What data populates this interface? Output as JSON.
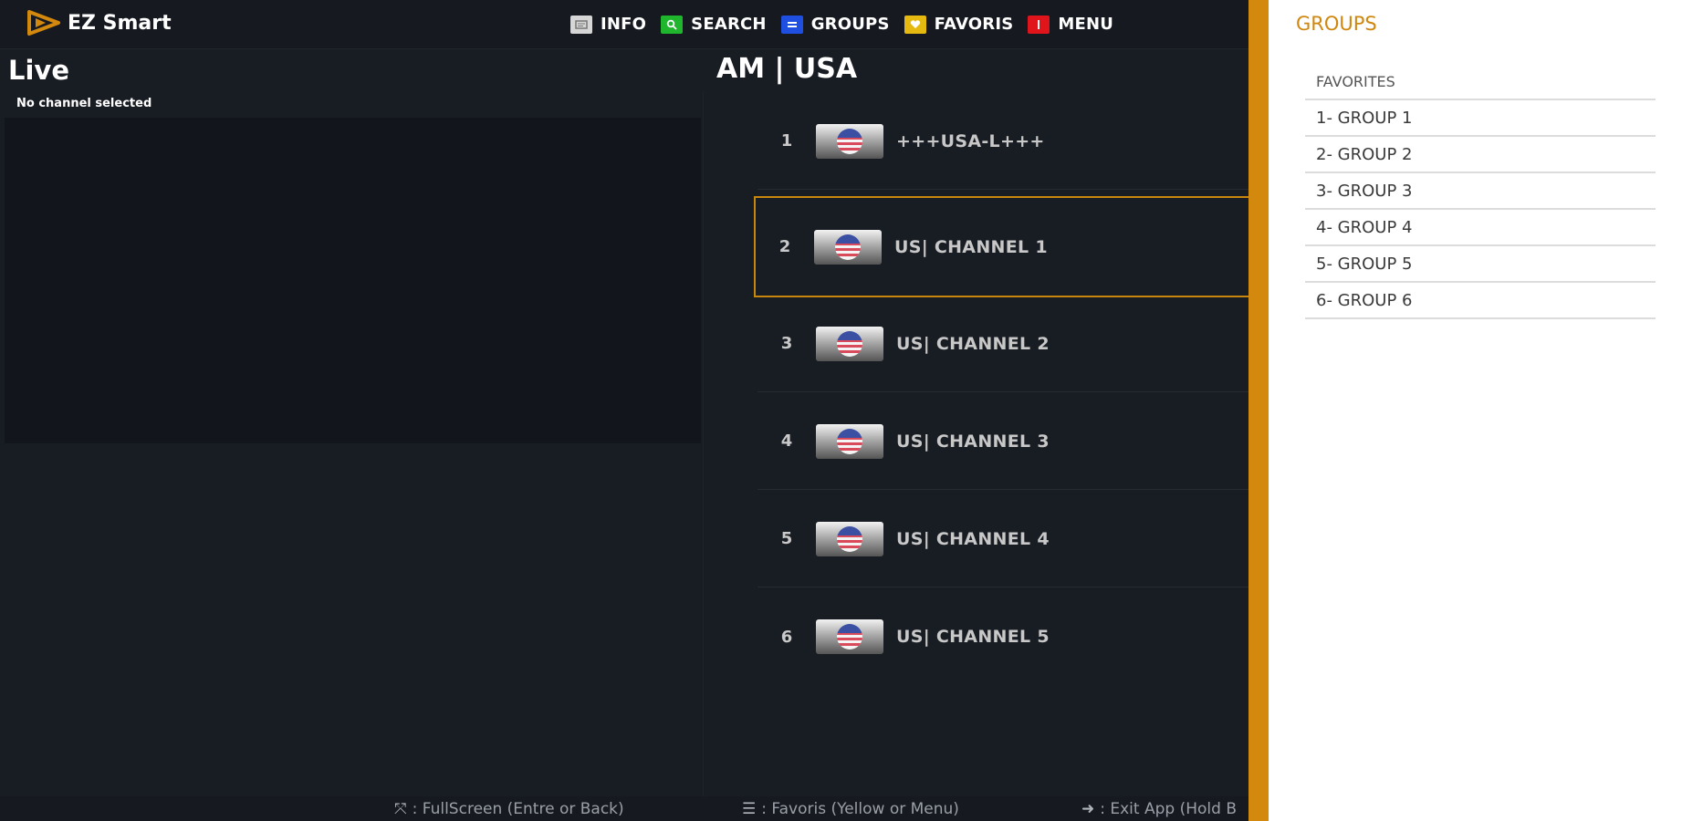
{
  "app": {
    "name": "EZ Smart",
    "brand_color": "#d3880e"
  },
  "header": {
    "hotkeys": [
      {
        "label": "INFO",
        "color": "#d6d6d6",
        "icon": "info-card-icon"
      },
      {
        "label": "SEARCH",
        "color": "#1fb52c",
        "icon": "search-icon"
      },
      {
        "label": "GROUPS",
        "color": "#1f4fe0",
        "icon": "list-icon"
      },
      {
        "label": "FAVORIS",
        "color": "#e5b90f",
        "icon": "heart-icon"
      },
      {
        "label": "MENU",
        "color": "#e0141b",
        "icon": "menu-icon"
      }
    ]
  },
  "live": {
    "title": "Live",
    "status": "No channel selected"
  },
  "channel_list": {
    "title": "AM | USA",
    "selected_index": 1,
    "channels": [
      {
        "number": "1",
        "name": "+++USA-L+++",
        "logo": "usa-flag-icon"
      },
      {
        "number": "2",
        "name": "US| CHANNEL 1",
        "logo": "usa-flag-icon"
      },
      {
        "number": "3",
        "name": "US| CHANNEL 2",
        "logo": "usa-flag-icon"
      },
      {
        "number": "4",
        "name": "US| CHANNEL 3",
        "logo": "usa-flag-icon"
      },
      {
        "number": "5",
        "name": "US| CHANNEL 4",
        "logo": "usa-flag-icon"
      },
      {
        "number": "6",
        "name": "US| CHANNEL 5",
        "logo": "usa-flag-icon"
      }
    ]
  },
  "footer": {
    "hints": [
      {
        "icon": "fullscreen-icon",
        "text": ": FullScreen (Entre or Back)"
      },
      {
        "icon": "list-icon",
        "text": ": Favoris (Yellow or Menu)"
      },
      {
        "icon": "exit-icon",
        "text": ": Exit App (Hold B"
      }
    ]
  },
  "groups_panel": {
    "title": "GROUPS",
    "items": [
      "FAVORITES",
      "1- GROUP 1",
      "2- GROUP 2",
      "3- GROUP 3",
      "4- GROUP 4",
      "5- GROUP 5",
      "6- GROUP 6"
    ]
  }
}
